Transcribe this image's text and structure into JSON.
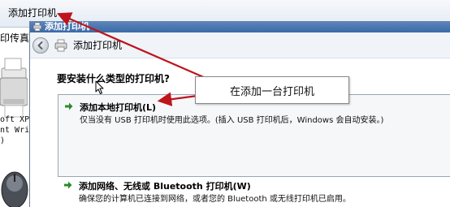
{
  "background": {
    "toolbar": {
      "add_printer_label": "添加打印机"
    },
    "left_pane": {
      "fax_label": "印传真",
      "printer_caption_lines": [
        "oft XPS",
        "nt Writ",
        ")"
      ]
    }
  },
  "dialog": {
    "title": "添加打印机",
    "nav_title": "添加打印机",
    "question": "要安装什么类型的打印机?",
    "options": [
      {
        "title": "添加本地打印机(L)",
        "description": "仅当没有 USB 打印机时使用此选项。(插入 USB 打印机后，Windows 会自动安装。)"
      },
      {
        "title": "添加网络、无线或 Bluetooth 打印机(W)",
        "description": "确保您的计算机已连接到网络，或者您的 Bluetooth 或无线打印机已启用。"
      }
    ]
  },
  "annotation": {
    "callout_text": "在添加一台打印机",
    "arrow_color": "#c0141c"
  },
  "colors": {
    "titlebar": "#3a6aa8",
    "option_arrow": "#2c8a2c"
  },
  "icons": [
    "back-arrow-icon",
    "printer-icon",
    "green-arrow-icon",
    "mouse-cursor-icon"
  ]
}
